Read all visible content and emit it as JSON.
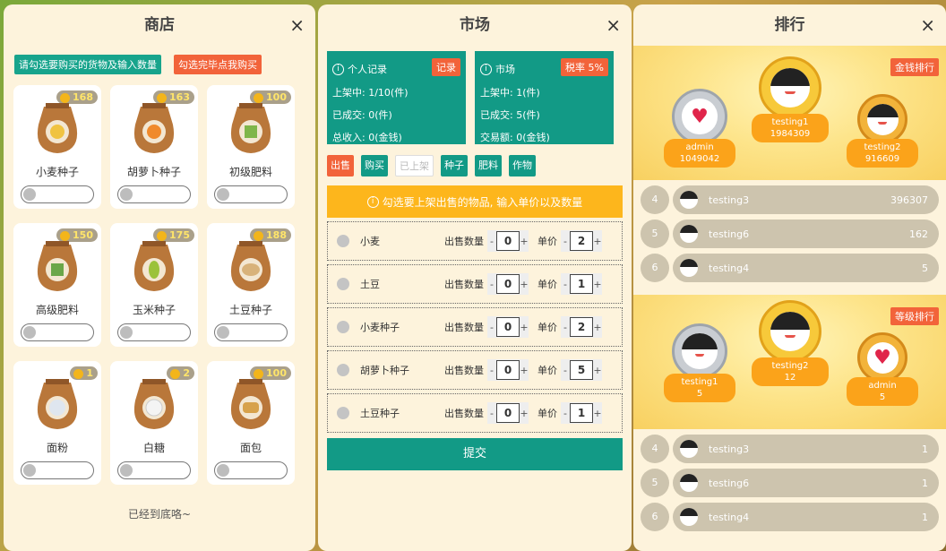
{
  "shop": {
    "title": "商店",
    "close": "×",
    "tag_select": "请勾选要购买的货物及输入数量",
    "tag_buy": "勾选完毕点我购买",
    "items": [
      {
        "name": "小麦种子",
        "price": "168",
        "color": "#f0c341"
      },
      {
        "name": "胡萝卜种子",
        "price": "163",
        "color": "#f08a2c"
      },
      {
        "name": "初级肥料",
        "price": "100",
        "color": "#7fb64a"
      },
      {
        "name": "高级肥料",
        "price": "150",
        "color": "#6aa64a"
      },
      {
        "name": "玉米种子",
        "price": "175",
        "color": "#9bc23a"
      },
      {
        "name": "土豆种子",
        "price": "188",
        "color": "#d8b27a"
      },
      {
        "name": "面粉",
        "price": "1",
        "color": "#dfe6ef"
      },
      {
        "name": "白糖",
        "price": "2",
        "color": "#f4f4f4"
      },
      {
        "name": "面包",
        "price": "100",
        "color": "#d7a24c"
      }
    ],
    "bottom_note": "已经到底咯~"
  },
  "market": {
    "title": "市场",
    "close": "×",
    "personal": {
      "title": "个人记录",
      "button": "记录",
      "listed": "上架中: 1/10(件)",
      "sold": "已成交: 0(件)",
      "income": "总收入: 0(金钱)"
    },
    "market_box": {
      "title": "市场",
      "button": "税率 5%",
      "listed": "上架中: 1(件)",
      "sold": "已成交: 5(件)",
      "volume": "交易额: 0(金钱)"
    },
    "filters": [
      "出售",
      "购买",
      "已上架",
      "种子",
      "肥料",
      "作物"
    ],
    "hint": "勾选要上架出售的物品, 输入单价以及数量",
    "qty_label": "出售数量",
    "price_label": "单价",
    "rows": [
      {
        "name": "小麦",
        "qty": "0",
        "price": "2"
      },
      {
        "name": "土豆",
        "qty": "0",
        "price": "1"
      },
      {
        "name": "小麦种子",
        "qty": "0",
        "price": "2"
      },
      {
        "name": "胡萝卜种子",
        "qty": "0",
        "price": "5"
      },
      {
        "name": "土豆种子",
        "qty": "0",
        "price": "1"
      }
    ],
    "submit": "提交"
  },
  "rank": {
    "title": "排行",
    "close": "×",
    "money": {
      "label": "金钱排行",
      "left": {
        "name": "admin",
        "value": "1049042"
      },
      "center": {
        "name": "testing1",
        "value": "1984309"
      },
      "right": {
        "name": "testing2",
        "value": "916609"
      },
      "list": [
        {
          "rank": "4",
          "name": "testing3",
          "score": "396307"
        },
        {
          "rank": "5",
          "name": "testing6",
          "score": "162"
        },
        {
          "rank": "6",
          "name": "testing4",
          "score": "5"
        }
      ]
    },
    "level": {
      "label": "等级排行",
      "left": {
        "name": "testing1",
        "value": "5"
      },
      "center": {
        "name": "testing2",
        "value": "12"
      },
      "right": {
        "name": "admin",
        "value": "5"
      },
      "list": [
        {
          "rank": "4",
          "name": "testing3",
          "score": "1"
        },
        {
          "rank": "5",
          "name": "testing6",
          "score": "1"
        },
        {
          "rank": "6",
          "name": "testing4",
          "score": "1"
        }
      ]
    }
  }
}
